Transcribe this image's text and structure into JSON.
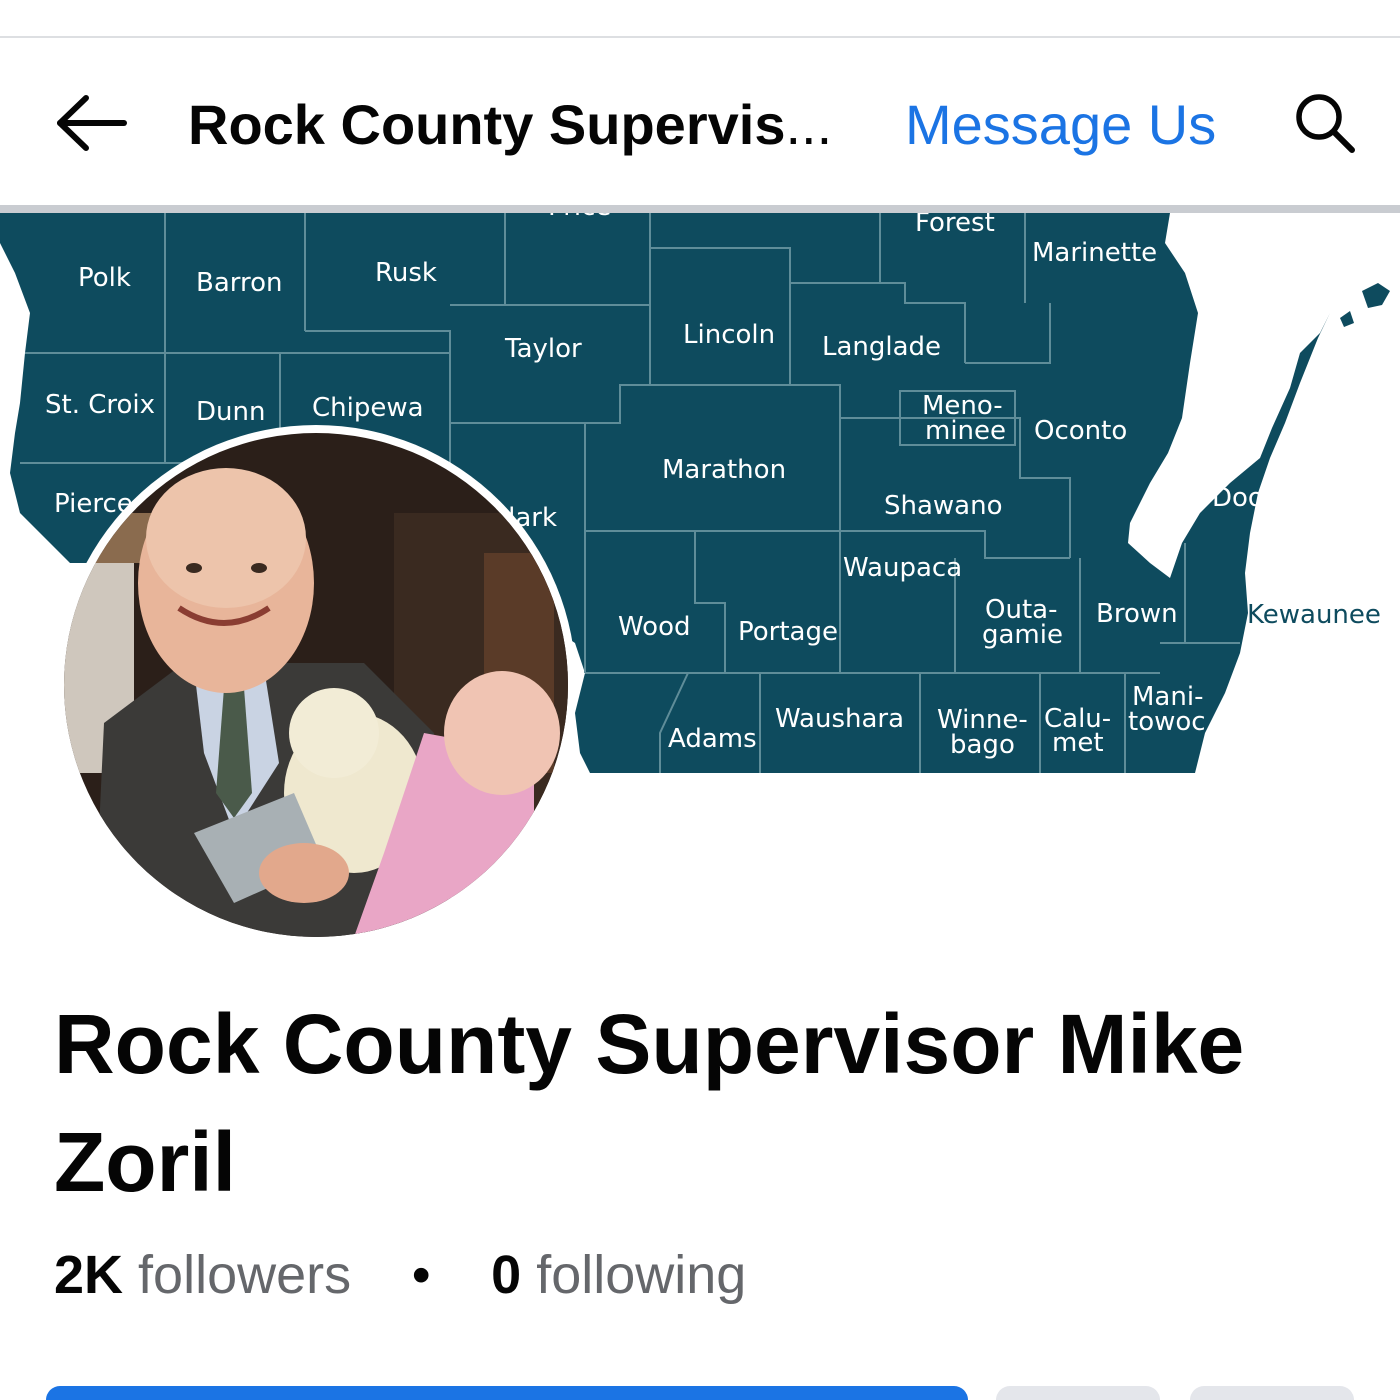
{
  "header": {
    "title": "Rock County Supervis",
    "title_ellipsis": "...",
    "message_label": "Message Us",
    "back_icon": "arrow-left-icon",
    "search_icon": "search-icon"
  },
  "cover": {
    "description_colors": {
      "map_fill": "#0e4b5e",
      "border": "#5f8d99",
      "water": "#ffffff"
    },
    "county_labels": {
      "polk": "Polk",
      "barron": "Barron",
      "rusk": "Rusk",
      "price": "Price",
      "forest": "Forest",
      "marinette": "Marinette",
      "taylor": "Taylor",
      "lincoln": "Lincoln",
      "langlade": "Langlade",
      "st_croix": "St. Croix",
      "dunn": "Dunn",
      "chippewa": "Chipewa",
      "menominee_1": "Meno-",
      "menominee_2": "minee",
      "oconto": "Oconto",
      "pierce": "Pierce",
      "clark": "Clark",
      "marathon": "Marathon",
      "shawano": "Shawano",
      "door": "Door",
      "waupaca": "Waupaca",
      "wood": "Wood",
      "portage": "Portage",
      "outagamie_1": "Outa-",
      "outagamie_2": "gamie",
      "brown": "Brown",
      "kewaunee": "Kewaunee",
      "adams": "Adams",
      "waushara": "Waushara",
      "winnebago_1": "Winne-",
      "winnebago_2": "bago",
      "calumet_1": "Calu-",
      "calumet_2": "met",
      "manitowoc_1": "Mani-",
      "manitowoc_2": "towoc"
    }
  },
  "profile": {
    "name": "Rock County Supervisor Mike Zoril",
    "followers_count": "2K",
    "followers_label": "followers",
    "separator": "•",
    "following_count": "0",
    "following_label": "following"
  },
  "colors": {
    "accent": "#1b74e4",
    "text": "#050505",
    "secondary_text": "#65676b",
    "map": "#0e4b5e"
  }
}
